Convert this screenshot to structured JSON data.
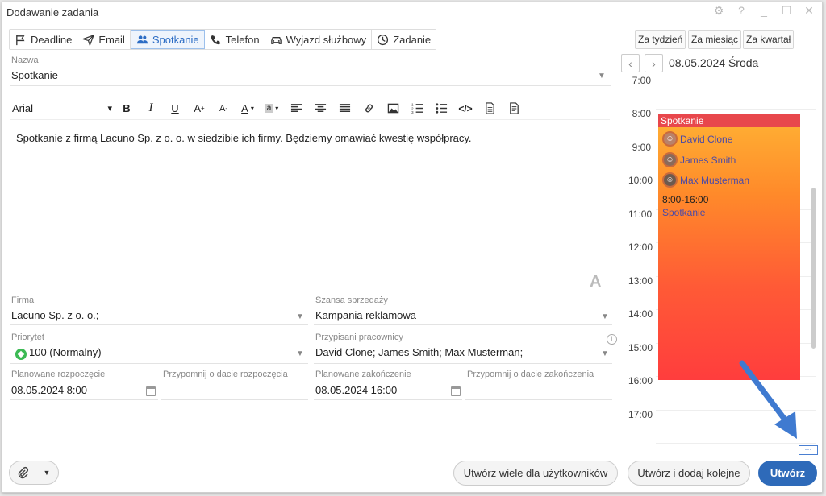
{
  "window": {
    "title": "Dodawanie zadania"
  },
  "types": [
    {
      "label": "Deadline",
      "icon": "flag-icon"
    },
    {
      "label": "Email",
      "icon": "send-icon"
    },
    {
      "label": "Spotkanie",
      "icon": "people-icon",
      "active": true
    },
    {
      "label": "Telefon",
      "icon": "phone-icon"
    },
    {
      "label": "Wyjazd służbowy",
      "icon": "car-icon"
    },
    {
      "label": "Zadanie",
      "icon": "clock-icon"
    }
  ],
  "name_field": {
    "label": "Nazwa",
    "value": "Spotkanie"
  },
  "editor": {
    "font": "Arial",
    "text": "Spotkanie z firmą Lacuno Sp. z o. o. w siedzibie ich firmy. Będziemy omawiać kwestię współpracy."
  },
  "fields": {
    "firma": {
      "label": "Firma",
      "value": "Lacuno Sp. z o. o.;"
    },
    "szansa": {
      "label": "Szansa sprzedaży",
      "value": "Kampania reklamowa"
    },
    "priorytet": {
      "label": "Priorytet",
      "value": "100 (Normalny)"
    },
    "pracownicy": {
      "label": "Przypisani pracownicy",
      "value": "David Clone; James Smith; Max Musterman;"
    },
    "start": {
      "label": "Planowane rozpoczęcie",
      "value": "08.05.2024 8:00"
    },
    "remind_start": {
      "label": "Przypomnij o dacie rozpoczęcia",
      "value": ""
    },
    "end": {
      "label": "Planowane zakończenie",
      "value": "08.05.2024 16:00"
    },
    "remind_end": {
      "label": "Przypomnij o dacie zakończenia",
      "value": ""
    }
  },
  "calendar": {
    "ranges": [
      "Za tydzień",
      "Za miesiąc",
      "Za kwartał"
    ],
    "date": "08.05.2024 Środa",
    "hours": [
      "7:00",
      "8:00",
      "9:00",
      "10:00",
      "11:00",
      "12:00",
      "13:00",
      "14:00",
      "15:00",
      "16:00",
      "17:00"
    ],
    "event": {
      "title": "Spotkanie",
      "attendees": [
        "David Clone",
        "James Smith",
        "Max Musterman"
      ],
      "time": "8:00-16:00",
      "name": "Spotkanie"
    }
  },
  "buttons": {
    "many": "Utwórz wiele dla użytkowników",
    "create_add": "Utwórz i dodaj kolejne",
    "create": "Utwórz"
  },
  "colors": {
    "accent": "#2e6ab9",
    "event_head": "#e8474c",
    "arrow": "#3f7ad0"
  }
}
